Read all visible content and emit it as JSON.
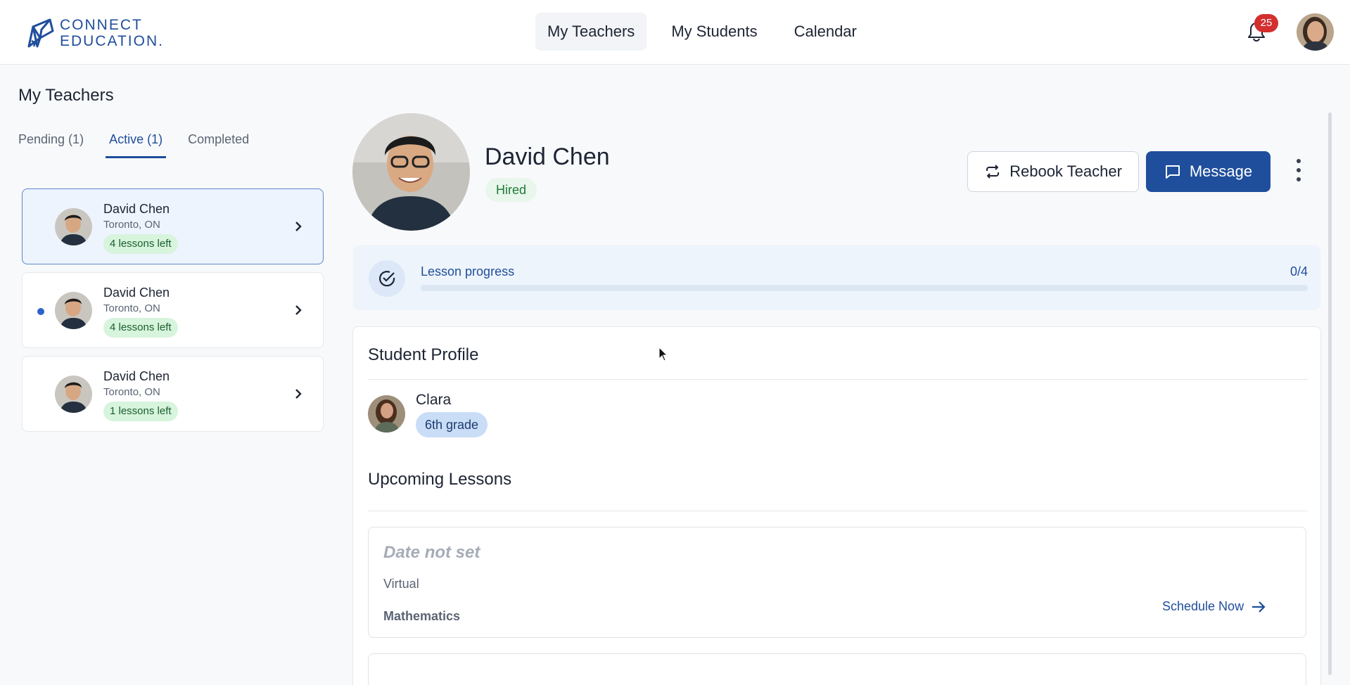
{
  "brand": {
    "line1": "CONNECT",
    "line2": "EDUCATION."
  },
  "nav": {
    "items": [
      "My Teachers",
      "My Students",
      "Calendar"
    ],
    "active": "My Teachers"
  },
  "notifications": {
    "count": "25"
  },
  "page": {
    "title": "My Teachers"
  },
  "tabs": [
    {
      "label": "Pending (1)"
    },
    {
      "label": "Active (1)"
    },
    {
      "label": "Completed"
    }
  ],
  "teacher_list": [
    {
      "name": "David Chen",
      "location": "Toronto, ON",
      "lessons": "4 lessons left"
    },
    {
      "name": "David Chen",
      "location": "Toronto, ON",
      "lessons": "4 lessons left"
    },
    {
      "name": "David Chen",
      "location": "Toronto, ON",
      "lessons": "1 lessons left"
    }
  ],
  "teacher": {
    "name": "David Chen",
    "status": "Hired"
  },
  "actions": {
    "rebook": "Rebook Teacher",
    "message": "Message"
  },
  "progress": {
    "label": "Lesson progress",
    "value_text": "0/4",
    "fraction": 0
  },
  "student_profile": {
    "title": "Student Profile",
    "name": "Clara",
    "grade": "6th grade"
  },
  "upcoming": {
    "title": "Upcoming Lessons",
    "lessons": [
      {
        "date": "Date not set",
        "mode": "Virtual",
        "subject": "Mathematics",
        "action": "Schedule Now"
      }
    ]
  },
  "colors": {
    "brand": "#1f4e9c",
    "badge": "#d32f2f",
    "lessons_pill": "#d7f4dd",
    "hired_pill": "#e8f6eb",
    "grade_pill": "#c9ddf7"
  }
}
